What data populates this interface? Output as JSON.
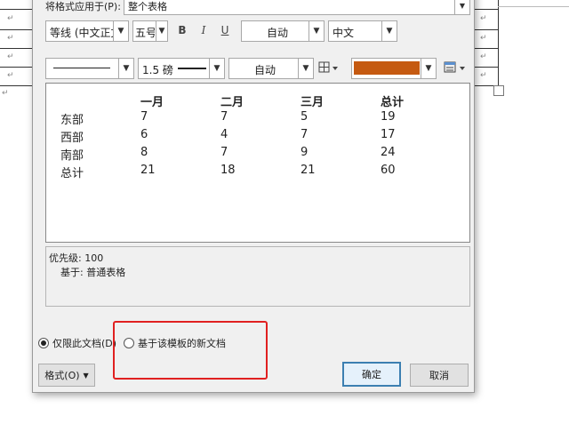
{
  "dialog": {
    "apply_to": {
      "label": "将格式应用于(P):",
      "value": "整个表格"
    },
    "font_row": {
      "font_name": "等线 (中文正文",
      "font_size": "五号",
      "bold": "B",
      "italic": "I",
      "underline": "U",
      "color": "自动",
      "script": "中文"
    },
    "border_row": {
      "line_weight": "1.5 磅",
      "line_color": "自动",
      "shading_color": "#c55a11"
    },
    "preview": {
      "header": [
        "",
        "一月",
        "二月",
        "三月",
        "总计"
      ],
      "rows": [
        [
          "东部",
          "7",
          "7",
          "5",
          "19"
        ],
        [
          "西部",
          "6",
          "4",
          "7",
          "17"
        ],
        [
          "南部",
          "8",
          "7",
          "9",
          "24"
        ],
        [
          "总计",
          "21",
          "18",
          "21",
          "60"
        ]
      ]
    },
    "description": {
      "line1": "优先级: 100",
      "line2": "基于: 普通表格"
    },
    "options": {
      "this_doc_only": "仅限此文档(D)",
      "new_docs_template": "基于该模板的新文档"
    },
    "buttons": {
      "format": "格式(O)",
      "ok": "确定",
      "cancel": "取消"
    }
  }
}
